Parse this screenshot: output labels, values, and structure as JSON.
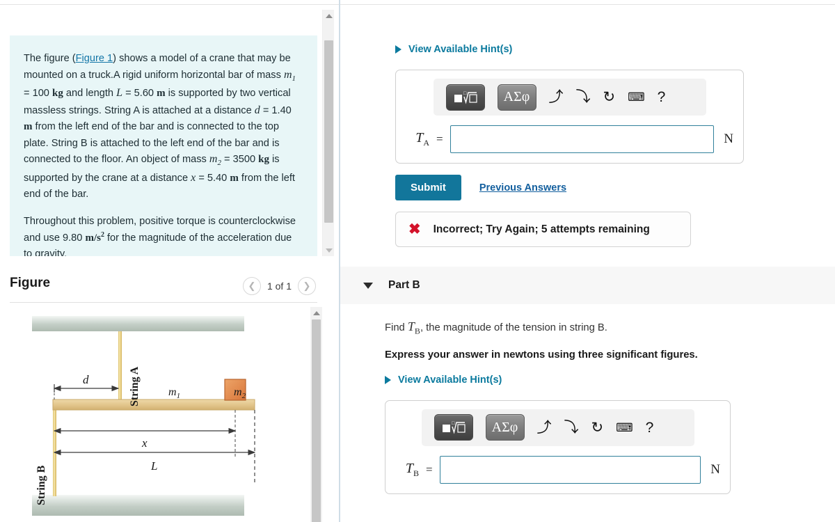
{
  "problem": {
    "paragraphs": [
      {
        "id": "p1",
        "segments": [
          {
            "t": "The figure ("
          },
          {
            "t": "Figure 1",
            "style": "link"
          },
          {
            "t": ") shows a model of a crane that may be mounted on a truck.A rigid uniform horizontal bar of mass "
          },
          {
            "t": "m",
            "style": "var",
            "sub": "1"
          },
          {
            "t": " = 100 "
          },
          {
            "t": "kg",
            "style": "unit"
          },
          {
            "t": " and length "
          },
          {
            "t": "L",
            "style": "var"
          },
          {
            "t": " = 5.60 "
          },
          {
            "t": "m",
            "style": "unit"
          },
          {
            "t": " is supported by two vertical massless strings. String A is attached at a distance "
          },
          {
            "t": "d",
            "style": "var"
          },
          {
            "t": " = 1.40 "
          },
          {
            "t": "m",
            "style": "unit"
          },
          {
            "t": " from the left end of the bar and is connected to the top plate. String B is attached to the left end of the bar and is connected to the floor. An object of mass "
          },
          {
            "t": "m",
            "style": "var",
            "sub": "2"
          },
          {
            "t": " = 3500 "
          },
          {
            "t": "kg",
            "style": "unit"
          },
          {
            "t": " is supported by the crane at a distance "
          },
          {
            "t": "x",
            "style": "var"
          },
          {
            "t": " = 5.40 "
          },
          {
            "t": "m",
            "style": "unit"
          },
          {
            "t": " from the left end of the bar."
          }
        ]
      },
      {
        "id": "p2",
        "segments": [
          {
            "t": "Throughout this problem, positive torque is counterclockwise and use 9.80 "
          },
          {
            "t": "m/s",
            "style": "unit",
            "sup": "2"
          },
          {
            "t": " for the magnitude of the acceleration due to gravity."
          }
        ]
      }
    ]
  },
  "figure": {
    "title": "Figure",
    "counter": "1 of 1",
    "prev_icon": "chevron-left-icon",
    "next_icon": "chevron-right-icon",
    "labels": {
      "string_a": "String A",
      "string_b": "String B",
      "mass_bar": "m",
      "mass_bar_sub": "1",
      "mass_block": "m",
      "mass_block_sub": "2",
      "dim_d": "d",
      "dim_x": "x",
      "dim_l": "L"
    },
    "colors": {
      "plate": "#b9c6bd",
      "bar": "#e3c68d",
      "bar_edge": "#c9a969",
      "block": "#e08a4e",
      "block_edge": "#b7642f",
      "string": "#f2d98a"
    }
  },
  "parts": [
    {
      "id": "part_a",
      "hint_label": "View Available Hint(s)",
      "answer": {
        "symbol": "T",
        "symbol_sub": "A",
        "equals": "=",
        "value": "",
        "unit": "N"
      },
      "toolbar": {
        "buttons": [
          {
            "name": "math-template-button",
            "glyph": "radical"
          },
          {
            "name": "greek-symbols-button",
            "label": "ΑΣφ"
          }
        ],
        "icons": [
          {
            "name": "undo-icon",
            "glyph": "↰"
          },
          {
            "name": "redo-icon",
            "glyph": "↱"
          },
          {
            "name": "reset-icon",
            "glyph": "↻"
          },
          {
            "name": "keyboard-icon",
            "glyph": "⌨"
          },
          {
            "name": "help-icon",
            "glyph": "?"
          }
        ]
      },
      "submit_label": "Submit",
      "previous_answers_label": "Previous Answers",
      "feedback": {
        "icon": "error-x-icon",
        "text": "Incorrect; Try Again; 5 attempts remaining",
        "color": "#d3122a"
      }
    },
    {
      "id": "part_b",
      "header": "Part B",
      "caret": "caret-down-icon",
      "prompt_prefix": "Find ",
      "prompt_symbol": "T",
      "prompt_symbol_sub": "B",
      "prompt_suffix": ", the magnitude of the tension in string B.",
      "instruction": "Express your answer in newtons using three significant figures.",
      "hint_label": "View Available Hint(s)",
      "answer": {
        "symbol": "T",
        "symbol_sub": "B",
        "equals": "=",
        "value": "",
        "unit": "N"
      },
      "toolbar": {
        "buttons": [
          {
            "name": "math-template-button",
            "glyph": "radical"
          },
          {
            "name": "greek-symbols-button",
            "label": "ΑΣφ"
          }
        ],
        "icons": [
          {
            "name": "undo-icon",
            "glyph": "↰"
          },
          {
            "name": "redo-icon",
            "glyph": "↱"
          },
          {
            "name": "reset-icon",
            "glyph": "↻"
          },
          {
            "name": "keyboard-icon",
            "glyph": "⌨"
          },
          {
            "name": "help-icon",
            "glyph": "?"
          }
        ]
      }
    }
  ],
  "theme": {
    "accent": "#0b7a9e",
    "submit_bg": "#12769b",
    "link": "#135f9e",
    "problem_bg": "#e8f6f7",
    "error": "#d3122a"
  }
}
